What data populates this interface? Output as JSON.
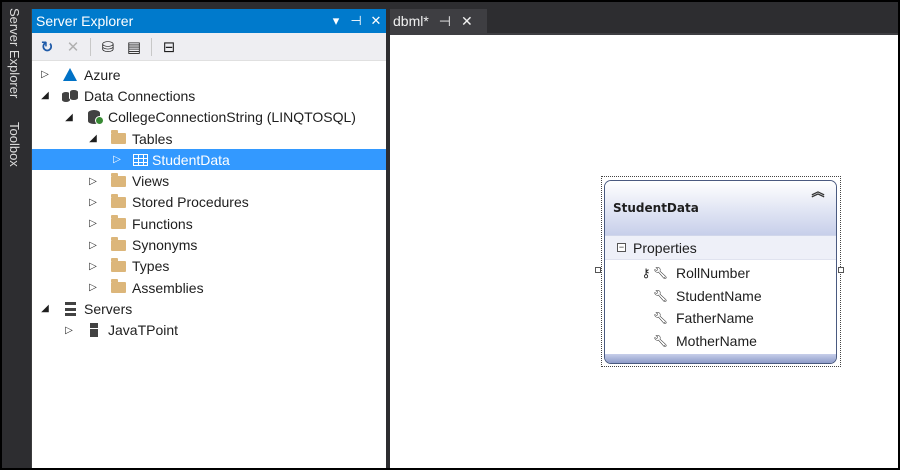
{
  "vertical_tabs": [
    "Server Explorer",
    "Toolbox"
  ],
  "server_explorer": {
    "title": "Server Explorer",
    "controls": {
      "dropdown": "▾",
      "pin": "⊣",
      "close": "✕"
    },
    "toolbar": {
      "refresh": "↻",
      "stop": "✕",
      "connect_database": "⛁",
      "connect_server": "▤",
      "filter": "⊟"
    },
    "tree": [
      {
        "label": "Azure",
        "expander": "▷",
        "icon": "azure-icon"
      },
      {
        "label": "Data Connections",
        "expander": "◢",
        "icon": "data-connections-icon"
      },
      {
        "label": "CollegeConnectionString (LINQTOSQL)",
        "expander": "◢",
        "icon": "database-icon"
      },
      {
        "label": "Tables",
        "expander": "◢",
        "icon": "folder-icon"
      },
      {
        "label": "StudentData",
        "expander": "▷",
        "icon": "table-icon",
        "selected": true
      },
      {
        "label": "Views",
        "expander": "▷",
        "icon": "folder-icon"
      },
      {
        "label": "Stored Procedures",
        "expander": "▷",
        "icon": "folder-icon"
      },
      {
        "label": "Functions",
        "expander": "▷",
        "icon": "folder-icon"
      },
      {
        "label": "Synonyms",
        "expander": "▷",
        "icon": "folder-icon"
      },
      {
        "label": "Types",
        "expander": "▷",
        "icon": "folder-icon"
      },
      {
        "label": "Assemblies",
        "expander": "▷",
        "icon": "folder-icon"
      },
      {
        "label": "Servers",
        "expander": "◢",
        "icon": "servers-icon"
      },
      {
        "label": "JavaTPoint",
        "expander": "▷",
        "icon": "server-icon"
      }
    ]
  },
  "document_tab": {
    "label": "dbml*",
    "pin": "⊣",
    "close": "✕"
  },
  "entity": {
    "name": "StudentData",
    "collapse_glyph": "︽",
    "section_label": "Properties",
    "section_toggle": "−",
    "properties": [
      {
        "name": "RollNumber",
        "primary_key": true
      },
      {
        "name": "StudentName",
        "primary_key": false
      },
      {
        "name": "FatherName",
        "primary_key": false
      },
      {
        "name": "MotherName",
        "primary_key": false
      }
    ]
  },
  "colors": {
    "title_bar": "#007acc",
    "selection": "#3399ff",
    "chrome": "#2d2d30",
    "folder": "#dcb67a"
  }
}
